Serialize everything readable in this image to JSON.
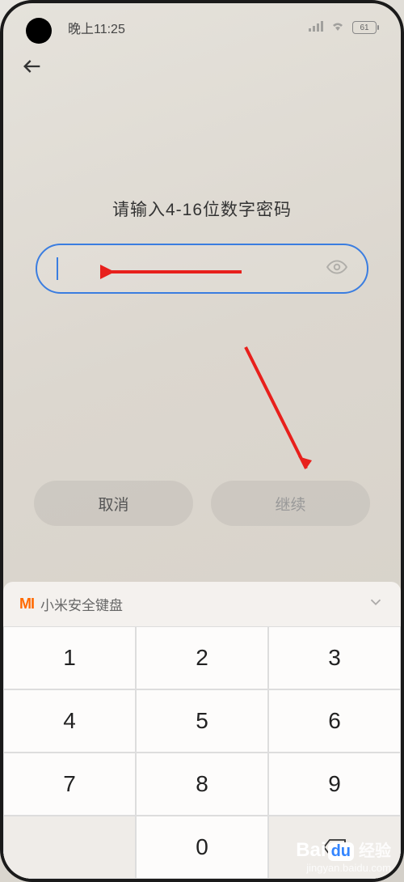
{
  "status": {
    "time": "晚上11:25",
    "battery": "61"
  },
  "nav": {},
  "prompt": "请输入4-16位数字密码",
  "input": {
    "value": ""
  },
  "buttons": {
    "cancel": "取消",
    "continue": "继续"
  },
  "keyboard": {
    "brand": "MI",
    "title": " 小米安全键盘",
    "keys": [
      "1",
      "2",
      "3",
      "4",
      "5",
      "6",
      "7",
      "8",
      "9",
      "",
      "0",
      "⌫"
    ]
  },
  "watermark": {
    "brand_bai": "Bai",
    "brand_du": "du",
    "brand_jy": "经验",
    "url": "jingyan.baidu.com"
  }
}
